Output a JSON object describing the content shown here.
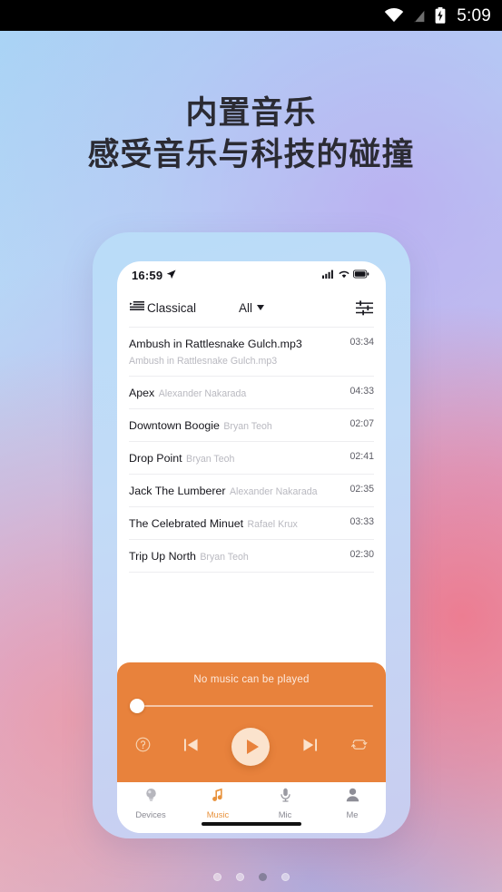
{
  "system_status_bar": {
    "wifi_icon": "wifi-icon",
    "signal_icon": "no-sim-signal-icon",
    "battery_icon": "battery-charging-icon",
    "clock": "5:09"
  },
  "promo": {
    "headline_line1": "内置音乐",
    "headline_line2": "感受音乐与科技的碰撞",
    "page_dots": {
      "count": 4,
      "active_index": 2
    }
  },
  "phone": {
    "status_bar": {
      "time": "16:59",
      "location_icon": "location-arrow-icon",
      "signal_icon": "cellular-signal-icon",
      "wifi_icon": "wifi-icon",
      "battery_icon": "battery-full-icon"
    },
    "app_bar": {
      "playlist_icon": "playlist-icon",
      "playlist_label": "Classical",
      "filter_label": "All",
      "filter_caret_icon": "chevron-down-icon",
      "equalizer_icon": "equalizer-sliders-icon"
    },
    "tracks": [
      {
        "title": "Ambush in Rattlesnake Gulch.mp3",
        "artist": "Ambush in Rattlesnake Gulch.mp3",
        "duration": "03:34"
      },
      {
        "title": "Apex",
        "artist": "Alexander Nakarada",
        "duration": "04:33"
      },
      {
        "title": "Downtown Boogie",
        "artist": "Bryan Teoh",
        "duration": "02:07"
      },
      {
        "title": "Drop Point",
        "artist": "Bryan Teoh",
        "duration": "02:41"
      },
      {
        "title": "Jack The Lumberer",
        "artist": "Alexander Nakarada",
        "duration": "02:35"
      },
      {
        "title": "The Celebrated Minuet",
        "artist": "Rafael Krux",
        "duration": "03:33"
      },
      {
        "title": "Trip Up North",
        "artist": "Bryan Teoh",
        "duration": "02:30"
      }
    ],
    "player": {
      "status_text": "No music can be played",
      "progress_percent": 0,
      "accent_color": "#e8823c",
      "controls": {
        "help_icon": "help-circle-icon",
        "previous_icon": "skip-previous-icon",
        "play_icon": "play-icon",
        "next_icon": "skip-next-icon",
        "repeat_icon": "repeat-icon"
      }
    },
    "bottom_nav": {
      "active_index": 1,
      "items": [
        {
          "label": "Devices",
          "icon": "device-bulb-icon"
        },
        {
          "label": "Music",
          "icon": "music-note-icon"
        },
        {
          "label": "Mic",
          "icon": "microphone-icon"
        },
        {
          "label": "Me",
          "icon": "person-icon"
        }
      ]
    }
  }
}
